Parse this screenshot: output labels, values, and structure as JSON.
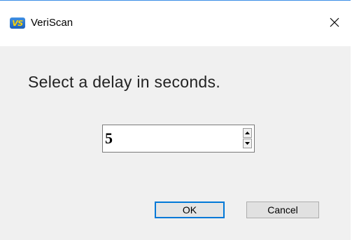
{
  "window": {
    "app_icon_text": "VS",
    "title": "VeriScan",
    "close_icon": "close-icon"
  },
  "dialog": {
    "prompt": "Select a delay in seconds.",
    "delay_value": "5",
    "ok_label": "OK",
    "cancel_label": "Cancel"
  },
  "colors": {
    "title_bar_border": "#3c8ee6",
    "default_button_border": "#0078d7",
    "dialog_background": "#f0f0f0"
  }
}
